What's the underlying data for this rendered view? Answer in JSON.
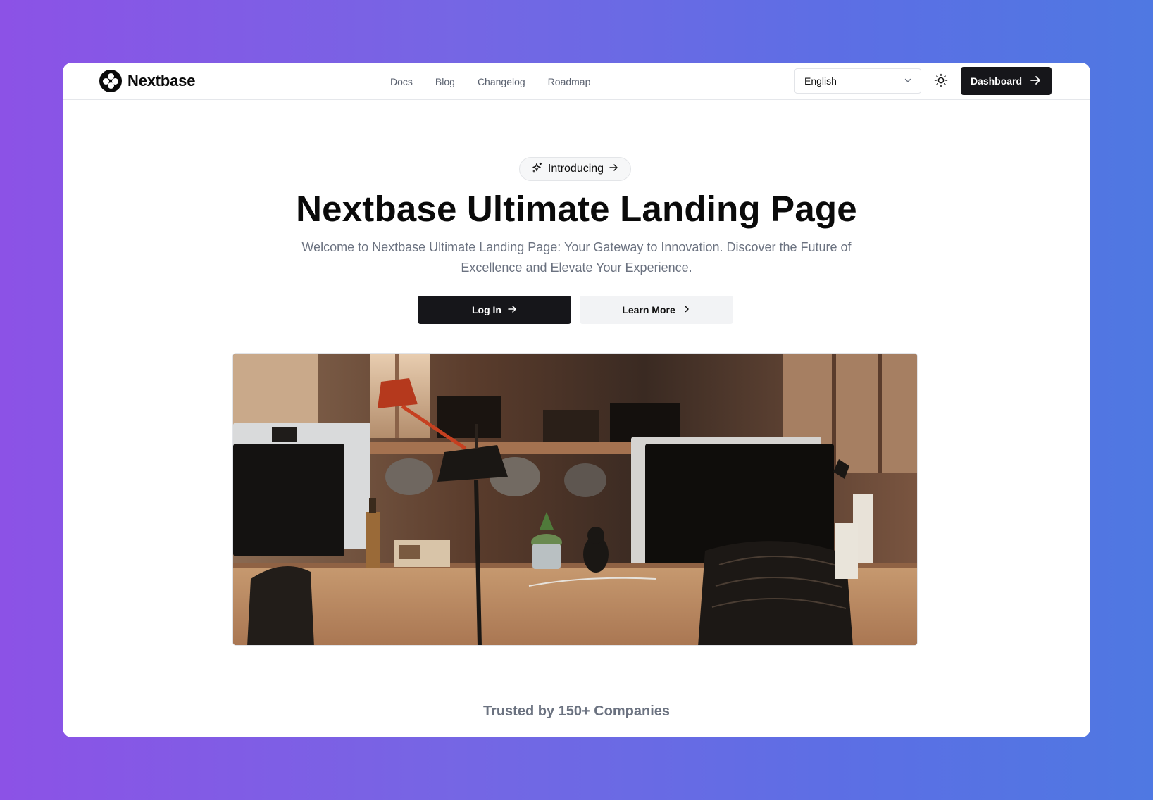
{
  "brand": {
    "name": "Nextbase",
    "logo_icon": "nextbase-logo-icon"
  },
  "nav": {
    "items": [
      {
        "label": "Docs"
      },
      {
        "label": "Blog"
      },
      {
        "label": "Changelog"
      },
      {
        "label": "Roadmap"
      }
    ]
  },
  "language_select": {
    "value": "English",
    "icon": "chevron-down-icon"
  },
  "theme_toggle": {
    "icon": "sun-icon"
  },
  "dashboard_button": {
    "label": "Dashboard",
    "icon": "arrow-right-icon"
  },
  "hero": {
    "badge": {
      "label": "Introducing",
      "leading_icon": "sparkles-icon",
      "trailing_icon": "arrow-right-icon"
    },
    "title": "Nextbase Ultimate Landing Page",
    "subtitle": "Welcome to Nextbase Ultimate Landing Page: Your Gateway to Innovation. Discover the Future of Excellence and Elevate Your Experience.",
    "primary_button": {
      "label": "Log In",
      "icon": "arrow-right-icon"
    },
    "secondary_button": {
      "label": "Learn More",
      "icon": "chevron-right-icon"
    },
    "image": "office-workspace-photo"
  },
  "trusted_by": {
    "text": "Trusted by 150+ Companies"
  },
  "colors": {
    "background_gradient_start": "#8c52e6",
    "background_gradient_end": "#4f78e2",
    "primary_button": "#16161a",
    "secondary_button": "#f2f3f5",
    "muted_text": "#6b7280"
  }
}
